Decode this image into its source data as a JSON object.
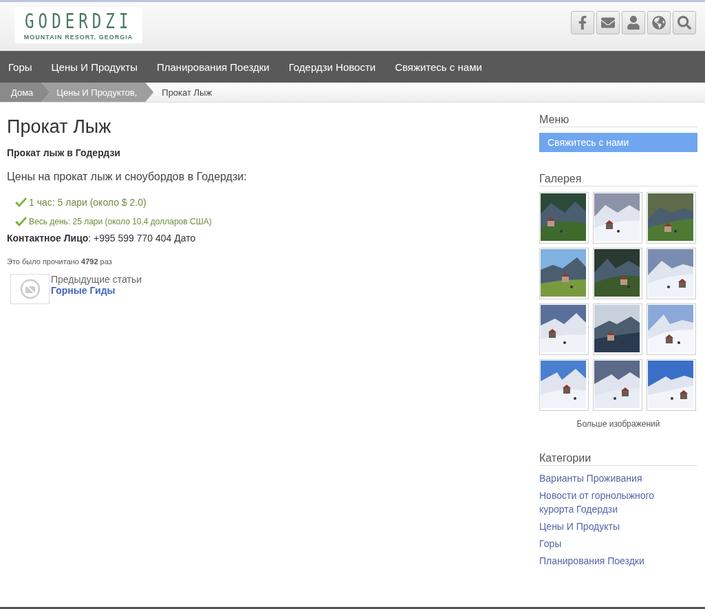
{
  "logo": {
    "title": "GODERDZI",
    "subtitle": "MOUNTAIN RESORT. GEORGIA"
  },
  "header_icons": [
    {
      "kind": "facebook"
    },
    {
      "kind": "mail"
    },
    {
      "kind": "user"
    },
    {
      "kind": "globe"
    },
    {
      "kind": "search"
    }
  ],
  "nav": [
    {
      "label": "Горы"
    },
    {
      "label": "Цены И Продукты"
    },
    {
      "label": "Планирования Поездки"
    },
    {
      "label": "Годердзи Новости"
    },
    {
      "label": "Свяжитесь с нами"
    }
  ],
  "breadcrumb": [
    {
      "label": "Дома",
      "kind": "link"
    },
    {
      "label": "Цены И Продуктов,",
      "kind": "link"
    },
    {
      "label": "Прокат Лыж",
      "kind": "current"
    }
  ],
  "article": {
    "title": "Прокат Лыж",
    "subtitle": "Прокат лыж в Годердзи",
    "lead": "Цены на прокат лыж и сноубордов в Годердзи:",
    "prices": [
      {
        "text": "1 час: 5 лари (около $ 2.0)",
        "kind": "large"
      },
      {
        "text": "Весь день: 25 лари (около 10,4 долларов США)",
        "kind": "small"
      }
    ],
    "contact": "**Контактное Лицо**: +995 599 770 404 Дато",
    "hits": "Это было прочитано **4792** раз",
    "previous": {
      "label": "Предыдущие статьи",
      "link": "Горные Гиды"
    }
  },
  "sidebar": {
    "menu": {
      "title": "Меню",
      "items": [
        {
          "label": "Свяжитесь с нами",
          "selected": true
        }
      ]
    },
    "gallery": {
      "title": "Галерея",
      "more": "Больше изображений"
    },
    "categories": {
      "title": "Категории",
      "items": [
        {
          "label": "Варианты Проживания"
        },
        {
          "label": "Новости от горнолыжного курорта Годердзи"
        },
        {
          "label": "Цены И Продукты"
        },
        {
          "label": "Горы"
        },
        {
          "label": "Планирования Поездки"
        }
      ]
    }
  }
}
